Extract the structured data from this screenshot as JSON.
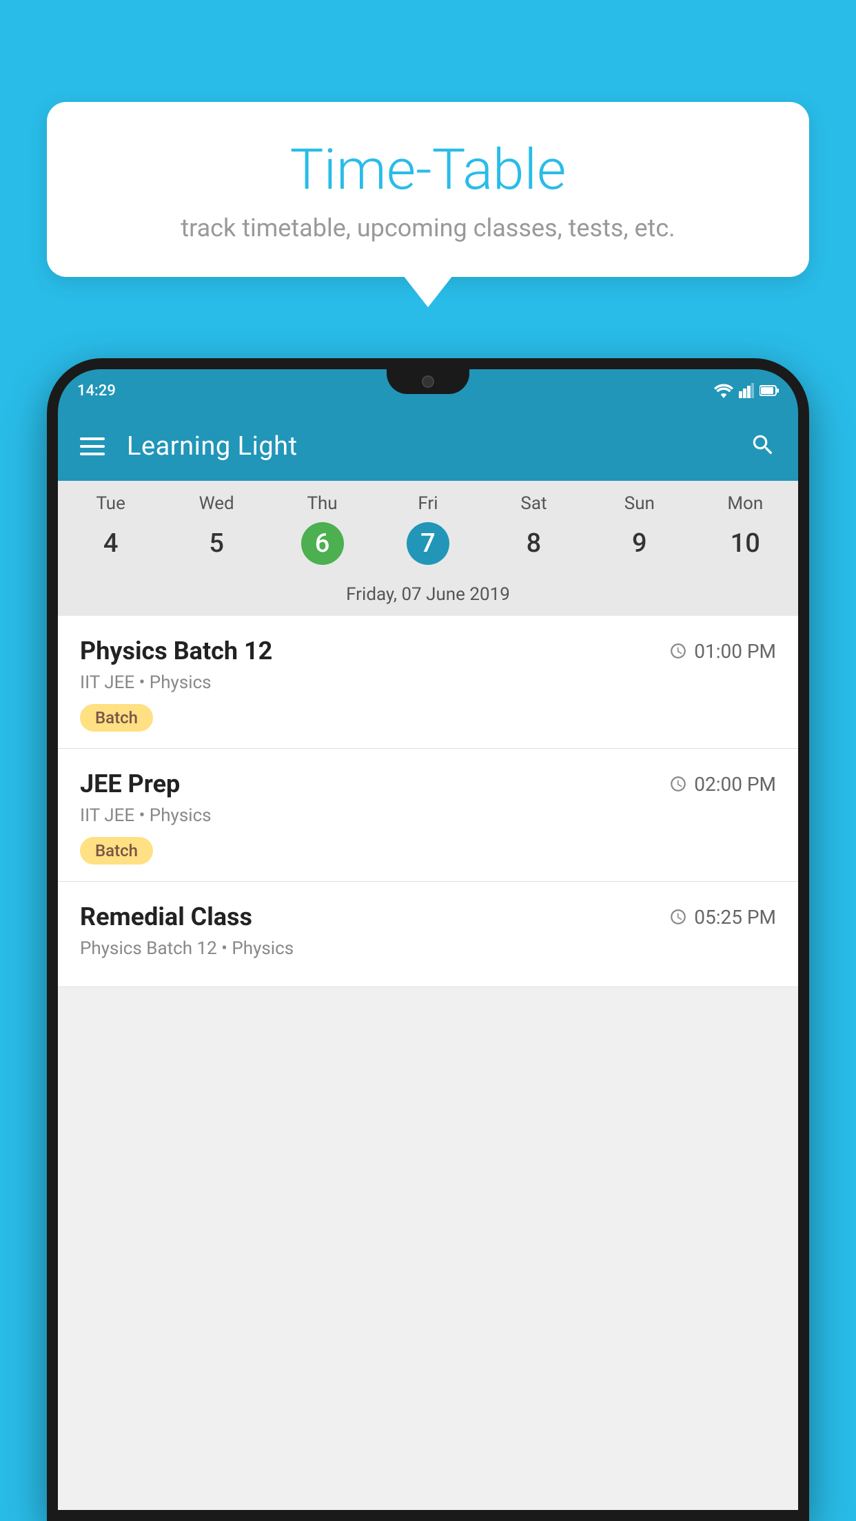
{
  "background_color": "#29bce8",
  "tooltip": {
    "title": "Time-Table",
    "subtitle": "track timetable, upcoming classes, tests, etc."
  },
  "phone": {
    "status_bar": {
      "time": "14:29"
    },
    "app_bar": {
      "title": "Learning Light",
      "menu_icon": "hamburger-icon",
      "search_icon": "search-icon"
    },
    "calendar": {
      "days": [
        "Tue",
        "Wed",
        "Thu",
        "Fri",
        "Sat",
        "Sun",
        "Mon"
      ],
      "dates": [
        "4",
        "5",
        "6",
        "7",
        "8",
        "9",
        "10"
      ],
      "today_index": 2,
      "selected_index": 3,
      "selected_date_label": "Friday, 07 June 2019"
    },
    "schedule": [
      {
        "title": "Physics Batch 12",
        "time": "01:00 PM",
        "subtitle": "IIT JEE • Physics",
        "badge": "Batch"
      },
      {
        "title": "JEE Prep",
        "time": "02:00 PM",
        "subtitle": "IIT JEE • Physics",
        "badge": "Batch"
      },
      {
        "title": "Remedial Class",
        "time": "05:25 PM",
        "subtitle": "Physics Batch 12 • Physics",
        "badge": null
      }
    ]
  }
}
